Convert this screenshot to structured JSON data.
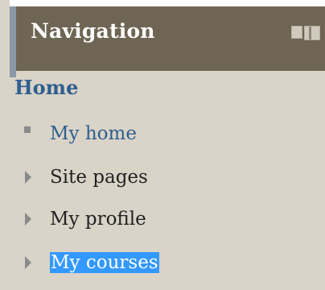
{
  "block": {
    "title": "Navigation",
    "controls": {
      "hide": "hide-block",
      "dock": "dock-block"
    }
  },
  "navigation": {
    "home_label": "Home",
    "items": [
      {
        "label": "My home",
        "marker": "square-bullet-icon",
        "type": "link"
      },
      {
        "label": "Site pages",
        "marker": "expand-triangle-icon",
        "type": "branch"
      },
      {
        "label": "My profile",
        "marker": "expand-triangle-icon",
        "type": "branch"
      },
      {
        "label": "My courses",
        "marker": "expand-triangle-icon",
        "type": "branch",
        "selected": true
      }
    ]
  },
  "colors": {
    "header_bg": "#6e6554",
    "panel_bg": "#d9d3c8",
    "link": "#2f5f8f",
    "selection": "#3399ff"
  }
}
